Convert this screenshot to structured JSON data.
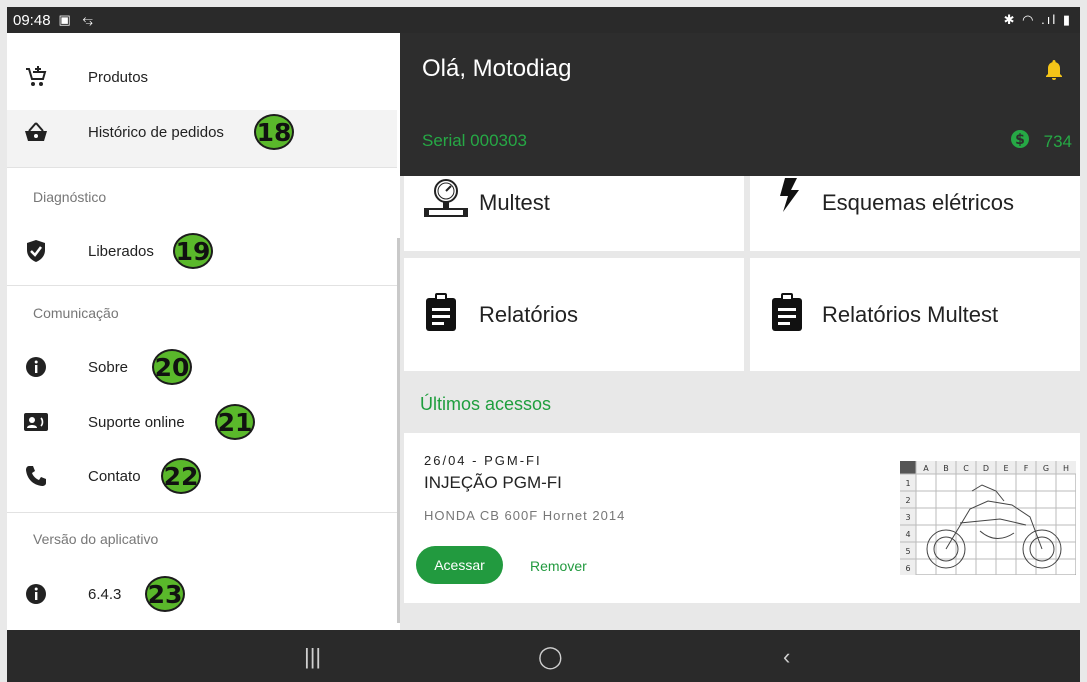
{
  "status_bar": {
    "time": "09:48",
    "left_icons": "▣ ⥃",
    "right_icons": "✱ ◠ .ıl ▮"
  },
  "header": {
    "greeting": "Olá, Motodiag",
    "serial": "Serial 000303",
    "credits": "734",
    "colors": {
      "background": "#2d2d2d",
      "accent": "#26a845",
      "bell": "#f5c518"
    }
  },
  "drawer": {
    "items_top": [
      {
        "label": "Produtos",
        "icon": "cart-plus-icon"
      },
      {
        "label": "Histórico de pedidos",
        "icon": "basket-icon",
        "badge": "18"
      }
    ],
    "sections": [
      {
        "title": "Diagnóstico",
        "items": [
          {
            "label": "Liberados",
            "icon": "shield-check-icon",
            "badge": "19"
          }
        ]
      },
      {
        "title": "Comunicação",
        "items": [
          {
            "label": "Sobre",
            "icon": "info-icon",
            "badge": "20"
          },
          {
            "label": "Suporte online",
            "icon": "contact-card-icon",
            "badge": "21"
          },
          {
            "label": "Contato",
            "icon": "phone-icon",
            "badge": "22"
          }
        ]
      },
      {
        "title": "Versão do aplicativo",
        "items": [
          {
            "label": "6.4.3",
            "icon": "info-icon",
            "badge": "23"
          }
        ]
      }
    ]
  },
  "main": {
    "cards": [
      {
        "label": "Multest",
        "icon": "gauge-icon"
      },
      {
        "label": "Esquemas elétricos",
        "icon": "lightning-icon"
      },
      {
        "label": "Relatórios",
        "icon": "clipboard-icon"
      },
      {
        "label": "Relatórios Multest",
        "icon": "clipboard-icon"
      }
    ],
    "recent_title": "Últimos acessos",
    "recent_item": {
      "code": "26/04 - PGM-FI",
      "name": "INJEÇÃO PGM-FI",
      "model": "HONDA CB 600F Hornet 2014",
      "open_label": "Acessar",
      "remove_label": "Remover",
      "grid_cols": [
        "A",
        "B",
        "C",
        "D",
        "E",
        "F",
        "G",
        "H"
      ],
      "grid_rows": [
        "1",
        "2",
        "3",
        "4",
        "5",
        "6"
      ]
    }
  },
  "navbar": {
    "recent": "|||",
    "home": "◯",
    "back": "‹"
  }
}
